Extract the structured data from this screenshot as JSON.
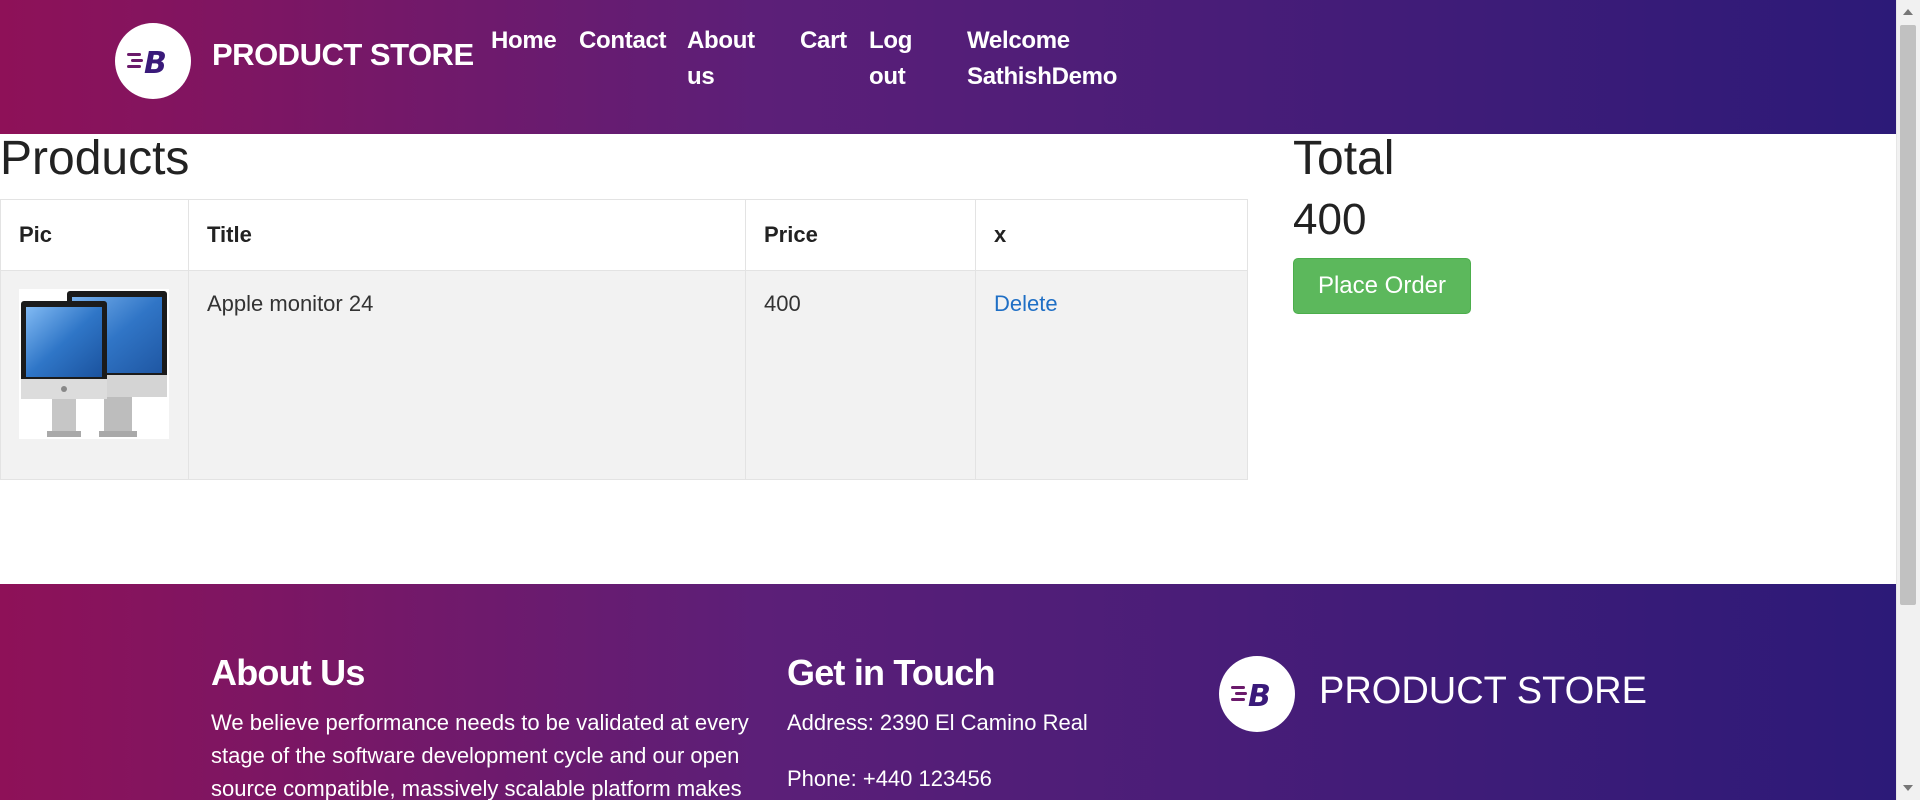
{
  "navbar": {
    "brand": "PRODUCT STORE",
    "links": {
      "home": "Home",
      "contact": "Contact",
      "about_line1": "About",
      "about_line2": "us",
      "cart": "Cart",
      "logout_line1": "Log",
      "logout_line2": "out",
      "welcome_line1": "Welcome",
      "welcome_line2": "SathishDemo"
    }
  },
  "products": {
    "title": "Products",
    "columns": [
      "Pic",
      "Title",
      "Price",
      "x"
    ],
    "rows": [
      {
        "image": "monitor-image",
        "title": "Apple monitor 24",
        "price": "400",
        "action": "Delete"
      }
    ]
  },
  "total": {
    "title": "Total",
    "value": "400",
    "button": "Place Order"
  },
  "footer": {
    "about": {
      "heading": "About Us",
      "line1": "We believe performance needs to be validated at every",
      "line2": "stage of the software development cycle and our open",
      "line3": "source compatible, massively scalable platform makes"
    },
    "contact": {
      "heading": "Get in Touch",
      "address": "Address: 2390 El Camino Real",
      "phone": "Phone: +440 123456"
    },
    "brand": "PRODUCT STORE"
  },
  "colors": {
    "gradient_start": "#8e1158",
    "gradient_end": "#2c1a78",
    "button_green": "#5cb85c",
    "link_blue": "#1f6fc5"
  }
}
